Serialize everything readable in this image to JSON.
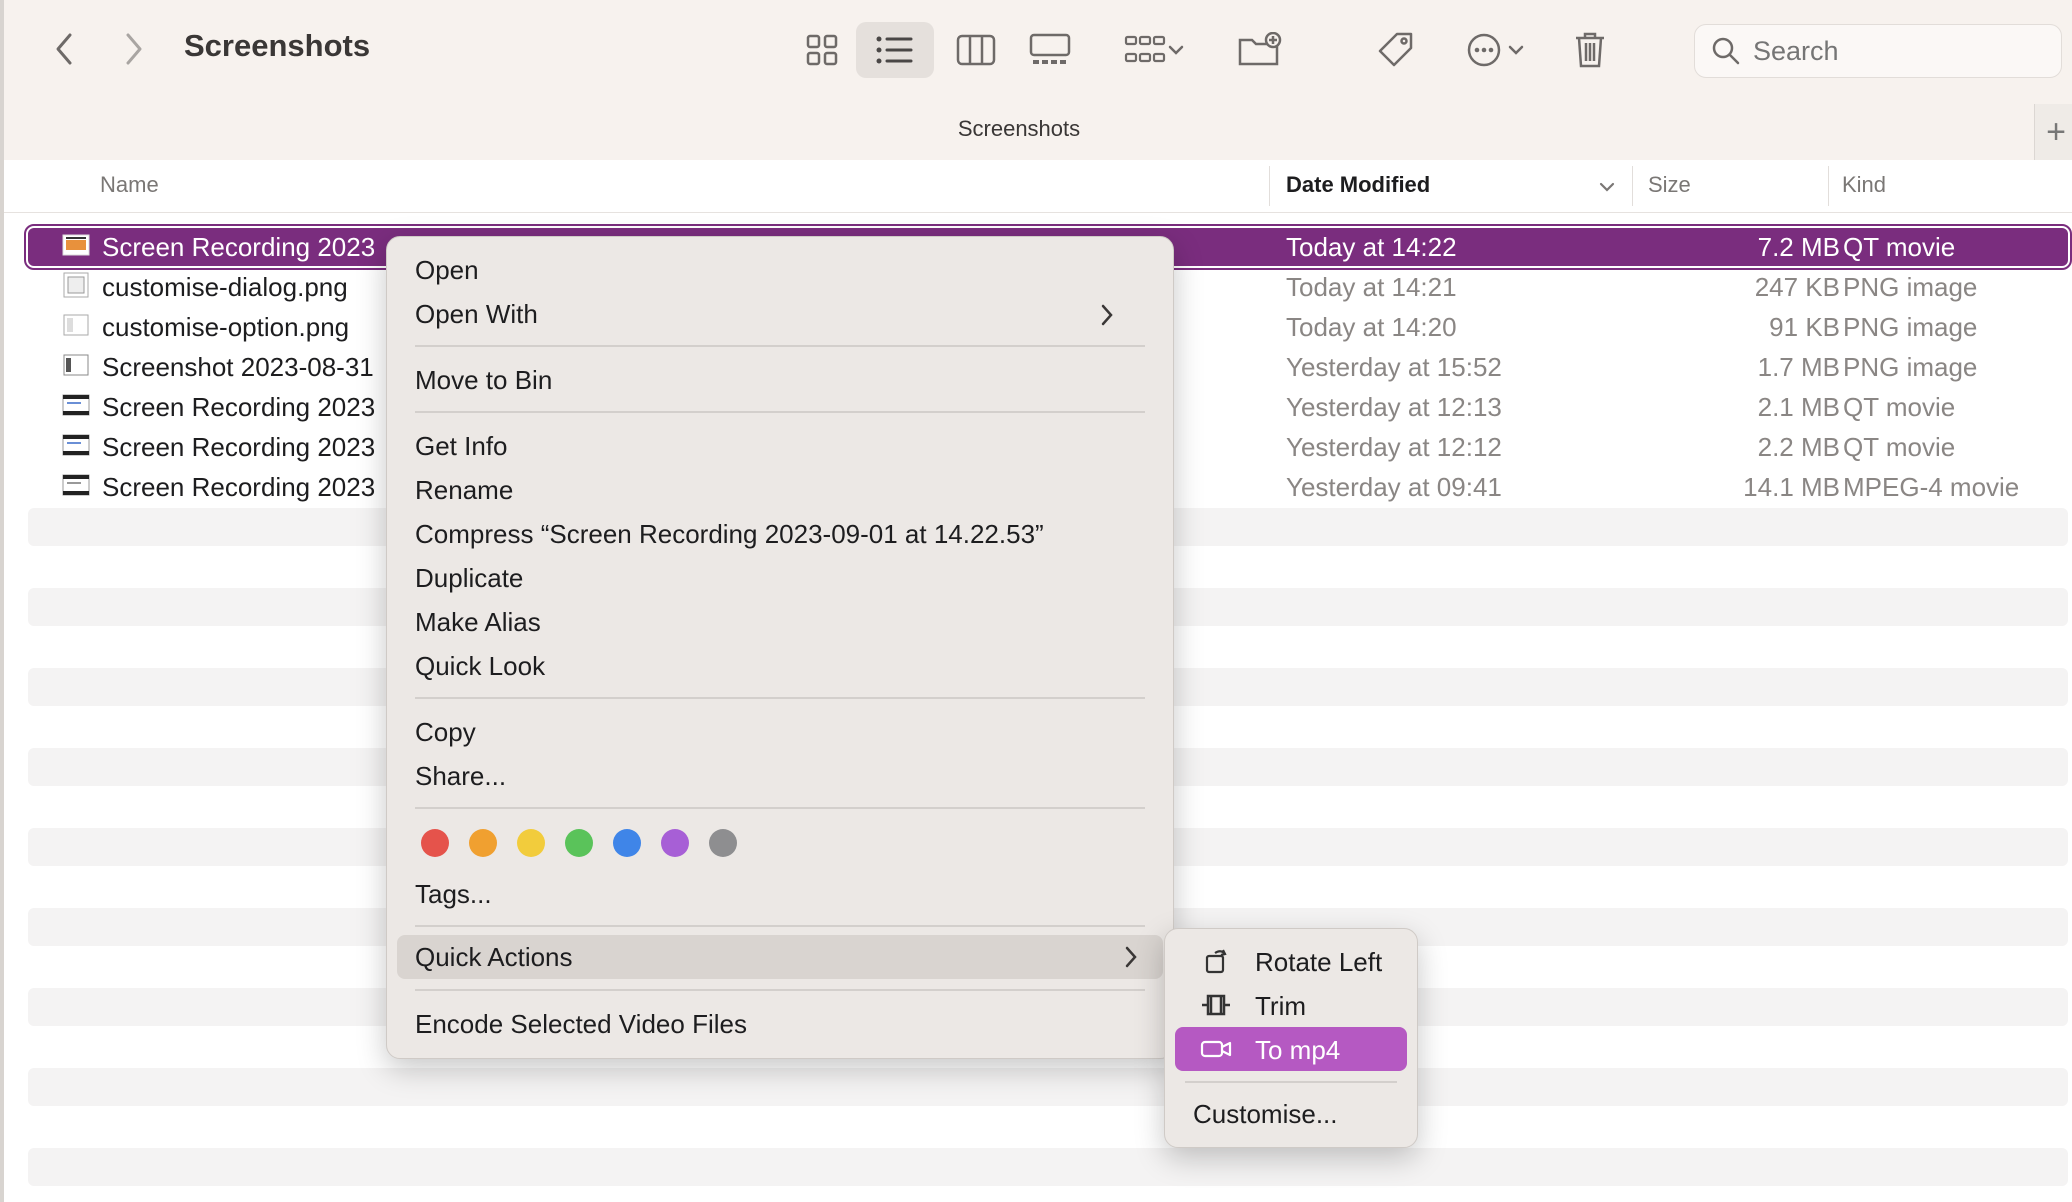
{
  "window": {
    "title": "Screenshots",
    "tab_title": "Screenshots",
    "tab_add": "+"
  },
  "search": {
    "placeholder": "Search",
    "value": ""
  },
  "columns": {
    "name": "Name",
    "date": "Date Modified",
    "size": "Size",
    "kind": "Kind"
  },
  "files": [
    {
      "name": "Screen Recording 2023-09-01 at 14.22.53",
      "visible_name": "Screen Recording 2023",
      "date": "Today at 14:22",
      "size": "7.2 MB",
      "kind": "QT movie",
      "selected": true
    },
    {
      "name": "customise-dialog.png",
      "visible_name": "customise-dialog.png",
      "date": "Today at 14:21",
      "size": "247 KB",
      "kind": "PNG image"
    },
    {
      "name": "customise-option.png",
      "visible_name": "customise-option.png",
      "date": "Today at 14:20",
      "size": "91 KB",
      "kind": "PNG image"
    },
    {
      "name": "Screenshot 2023-08-31",
      "visible_name": "Screenshot 2023-08-31",
      "date": "Yesterday at 15:52",
      "size": "1.7 MB",
      "kind": "PNG image"
    },
    {
      "name": "Screen Recording 2023",
      "visible_name": "Screen Recording 2023",
      "date": "Yesterday at 12:13",
      "size": "2.1 MB",
      "kind": "QT movie"
    },
    {
      "name": "Screen Recording 2023",
      "visible_name": "Screen Recording 2023",
      "date": "Yesterday at 12:12",
      "size": "2.2 MB",
      "kind": "QT movie"
    },
    {
      "name": "Screen Recording 2023",
      "visible_name": "Screen Recording 2023",
      "date": "Yesterday at 09:41",
      "size": "14.1 MB",
      "kind": "MPEG-4 movie"
    }
  ],
  "context_menu": {
    "open": "Open",
    "open_with": "Open With",
    "move_to_bin": "Move to Bin",
    "get_info": "Get Info",
    "rename": "Rename",
    "compress": "Compress “Screen Recording 2023-09-01 at 14.22.53”",
    "duplicate": "Duplicate",
    "make_alias": "Make Alias",
    "quick_look": "Quick Look",
    "copy": "Copy",
    "share": "Share...",
    "tags": "Tags...",
    "quick_actions": "Quick Actions",
    "encode": "Encode Selected Video Files",
    "tag_colors": [
      "#e5534b",
      "#f0a030",
      "#f2cc3c",
      "#5ac35a",
      "#3f85e8",
      "#a75fd6",
      "#8e8e90"
    ]
  },
  "quick_actions_menu": {
    "rotate_left": "Rotate Left",
    "trim": "Trim",
    "to_mp4": "To mp4",
    "customise": "Customise..."
  },
  "colors": {
    "selection": "#7a2d7e",
    "submenu_highlight": "#b559c2"
  }
}
